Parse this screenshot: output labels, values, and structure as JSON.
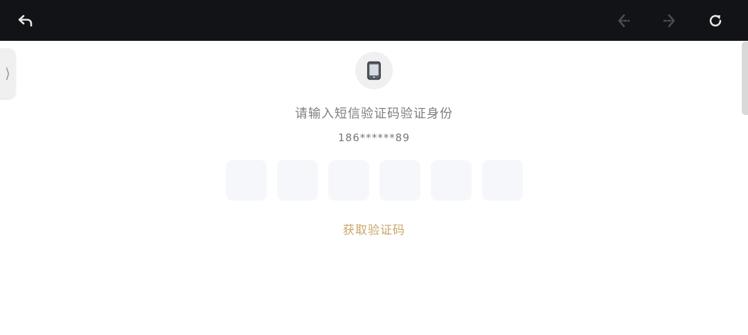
{
  "toolbar": {
    "back_icon": "undo-arrow-icon",
    "nav_back_icon": "arrow-left-icon",
    "nav_forward_icon": "arrow-right-icon",
    "refresh_icon": "refresh-icon",
    "background": "#121316"
  },
  "verify": {
    "icon": "mobile-phone-icon",
    "title": "请输入短信验证码验证身份",
    "phone": "186******89",
    "code_length": 6,
    "code_values": [
      "",
      "",
      "",
      "",
      "",
      ""
    ],
    "get_code_label": "获取验证码",
    "accent_color": "#cba46b"
  },
  "side_handle": {
    "glyph": "⟩"
  }
}
